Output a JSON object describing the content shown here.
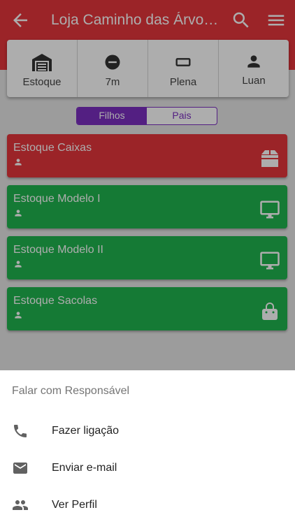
{
  "colors": {
    "primary": "#e5353b",
    "card_red": "#e5353b",
    "card_green": "#20b44f",
    "toggle_accent": "#7b2fc0",
    "icon_grey": "#616161"
  },
  "appbar": {
    "title": "Loja Caminho das Árvores",
    "back_icon": "arrow-back-icon",
    "search_icon": "search-icon",
    "menu_icon": "menu-icon"
  },
  "summary": [
    {
      "label": "Estoque",
      "icon": "warehouse-icon"
    },
    {
      "label": "7m",
      "icon": "minus-circle-icon"
    },
    {
      "label": "Plena",
      "icon": "rectangle-outline-icon"
    },
    {
      "label": "Luan",
      "icon": "person-icon"
    }
  ],
  "toggle": {
    "active": "Filhos",
    "inactive": "Pais"
  },
  "items": [
    {
      "name": "Estoque Caixas",
      "color": "red",
      "icon": "box-icon"
    },
    {
      "name": "Estoque Modelo I",
      "color": "green",
      "icon": "monitor-icon"
    },
    {
      "name": "Estoque Modelo II",
      "color": "green",
      "icon": "monitor-icon"
    },
    {
      "name": "Estoque Sacolas",
      "color": "green",
      "icon": "shopping-bag-icon"
    }
  ],
  "sheet": {
    "title": "Falar com Responsável",
    "actions": [
      {
        "label": "Fazer ligação",
        "icon": "phone-icon"
      },
      {
        "label": "Enviar e-mail",
        "icon": "email-icon"
      },
      {
        "label": "Ver Perfil",
        "icon": "people-icon"
      }
    ]
  }
}
